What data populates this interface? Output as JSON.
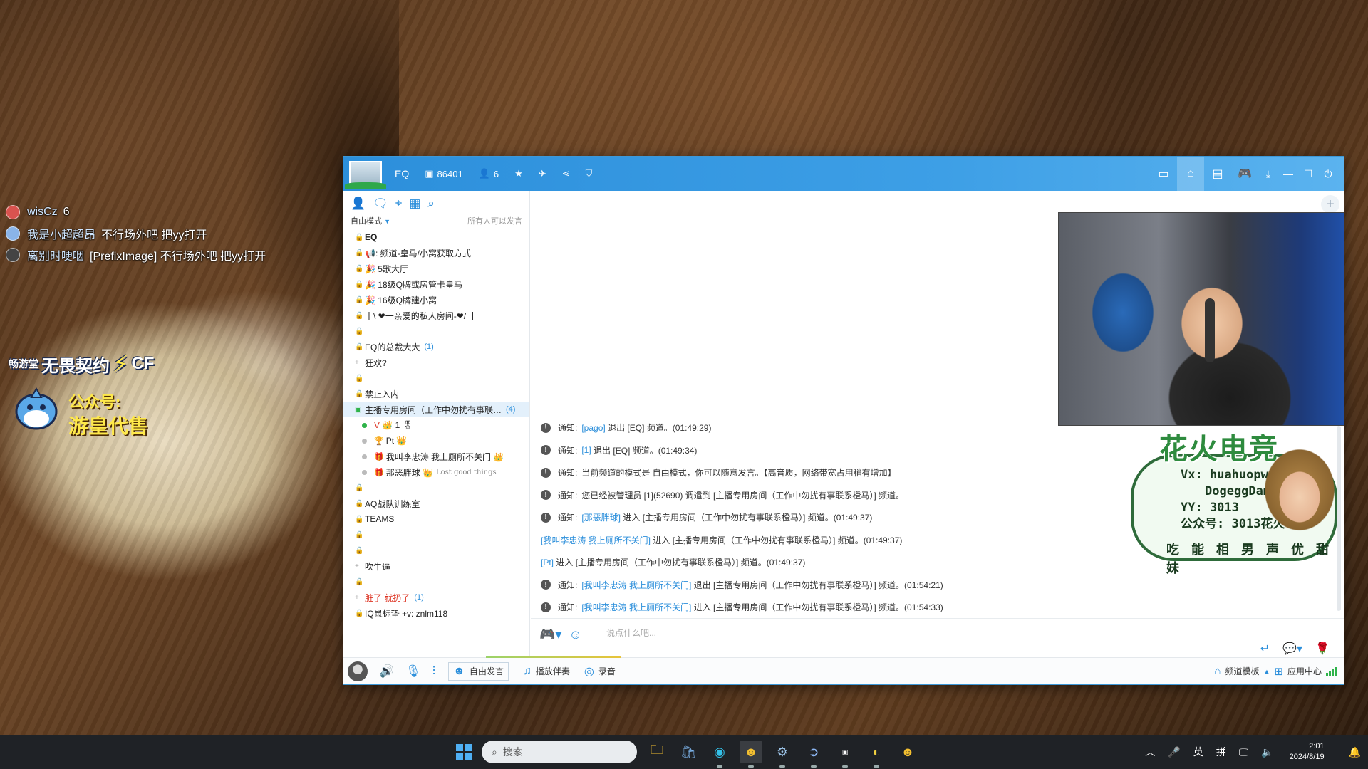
{
  "overlay_chat": [
    {
      "name": "wisCz",
      "message": "6",
      "avatar_color": "#d9534f"
    },
    {
      "name": "我是小超超昂",
      "message": "不行场外吧 把yy打开",
      "avatar_color": "#8ab4e8"
    },
    {
      "name": "离别时哽咽",
      "message": "[PrefixImage] 不行场外吧 把yy打开",
      "avatar_color": "#444444"
    }
  ],
  "ad_overlay": {
    "brand_small": "畅游堂",
    "brand_main": "无畏契约",
    "brand_cf": "CF",
    "sub_line1": "公众号:",
    "sub_line2": "游皇代售"
  },
  "window": {
    "room_name": "EQ",
    "room_id": "86401",
    "online_count": "6",
    "accent": "#2c8fdb"
  },
  "sidebar": {
    "mode_label": "自由模式",
    "mode_hint": "所有人可以发言",
    "channels": [
      {
        "label": "EQ",
        "bold": true
      },
      {
        "label": "📢: 频道-皇马/小窝获取方式"
      },
      {
        "label": "🎉 5歌大厅"
      },
      {
        "label": "🎉 18级Q牌或房管卡皇马"
      },
      {
        "label": "🎉 16级Q牌建小窝"
      },
      {
        "label": "丨\\ ❤一亲爱的私人房间-❤/ 丨"
      },
      {
        "label": ""
      },
      {
        "label": "EQ的总裁大大",
        "count": "(1)"
      },
      {
        "label": "狂欢?",
        "expand": true
      },
      {
        "label": ""
      },
      {
        "label": "禁止入内"
      },
      {
        "label": "主播专用房间（工作中勿扰有事联…",
        "count": "(4)",
        "selected": true
      }
    ],
    "users": [
      {
        "label": "1 🎖",
        "badge": "V 👑",
        "online": true
      },
      {
        "label": "Pt 👑"
      },
      {
        "label": "我叫李忠涛 我上厕所不关门 👑"
      },
      {
        "label": "那恶胖球 👑",
        "tag": "Lost good things"
      }
    ],
    "channels_after": [
      {
        "label": ""
      },
      {
        "label": "AQ战队训练室"
      },
      {
        "label": "TEAMS"
      },
      {
        "label": ""
      },
      {
        "label": ""
      },
      {
        "label": "吹牛逼",
        "expand": true
      },
      {
        "label": ""
      },
      {
        "label": "脏了 就扔了",
        "count": "(1)",
        "red_prefix": true,
        "expand": true
      },
      {
        "label": "IQ鼠标垫 +v: znlm118"
      }
    ]
  },
  "messages": [
    {
      "label": "通知:",
      "user": "[pago]",
      "text": "退出 [EQ] 频道。(01:49:29)",
      "notice": true
    },
    {
      "label": "通知:",
      "user": "[1]",
      "text": "退出 [EQ] 频道。(01:49:34)",
      "notice": true
    },
    {
      "label": "通知:",
      "user": "",
      "text": "当前频道的模式是 自由模式，你可以随意发言。【高音质，网络带宽占用稍有增加】",
      "notice": true
    },
    {
      "label": "通知:",
      "user": "",
      "text": "您已经被管理员 [1](52690) 调遣到 [主播专用房间（工作中勿扰有事联系橙马）] 频道。",
      "notice": true
    },
    {
      "label": "通知:",
      "user": "[那恶胖球]",
      "text": "进入 [主播专用房间（工作中勿扰有事联系橙马）] 频道。(01:49:37)",
      "notice": true
    },
    {
      "label": "",
      "user": "[我叫李忠涛 我上厕所不关门]",
      "text": "进入 [主播专用房间（工作中勿扰有事联系橙马）] 频道。(01:49:37)",
      "notice": false
    },
    {
      "label": "",
      "user": "[Pt]",
      "text": "进入 [主播专用房间（工作中勿扰有事联系橙马）] 频道。(01:49:37)",
      "notice": false
    },
    {
      "label": "通知:",
      "user": "[我叫李忠涛 我上厕所不关门]",
      "text": "退出 [主播专用房间（工作中勿扰有事联系橙马）] 频道。(01:54:21)",
      "notice": true
    },
    {
      "label": "通知:",
      "user": "[我叫李忠涛 我上厕所不关门]",
      "text": "进入 [主播专用房间（工作中勿扰有事联系橙马）] 频道。(01:54:33)",
      "notice": true
    }
  ],
  "input": {
    "placeholder": "说点什么吧..."
  },
  "brand_overlay": {
    "title": "花火电竞",
    "vx_label": "Vx:",
    "vx_1": "huahuopwd",
    "vx_2": "DogeggDamn",
    "yy": "YY: 3013",
    "gzh": "公众号: 3013花火电竞",
    "slogan": "吃 能 相 男  声 优 甜 妹"
  },
  "bottom_bar": {
    "free_speak": "自由发言",
    "companion": "播放伴奏",
    "record": "录音",
    "channel_template": "频道模板",
    "app_center": "应用中心"
  },
  "taskbar": {
    "search": "搜索",
    "ime_lang": "英",
    "ime_mode": "拼",
    "time": "2:01",
    "date": "2024/8/19"
  }
}
